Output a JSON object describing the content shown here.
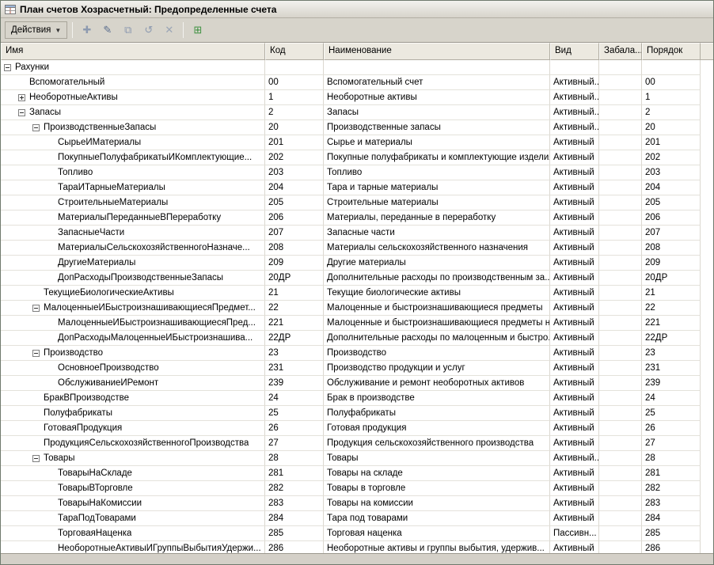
{
  "window": {
    "title": "План счетов Хозрасчетный: Предопределенные счета"
  },
  "toolbar": {
    "actions_label": "Действия",
    "dropdown_arrow": "▼",
    "buttons": [
      {
        "name": "add",
        "glyph": "✚",
        "color": "#8d9ab0"
      },
      {
        "name": "edit",
        "glyph": "✎",
        "color": "#5b6e8e"
      },
      {
        "name": "copy",
        "glyph": "⧉",
        "color": "#8d9ab0"
      },
      {
        "name": "history",
        "glyph": "↺",
        "color": "#8d9ab0"
      },
      {
        "name": "delete",
        "glyph": "✕",
        "color": "#9aa5b6"
      },
      {
        "name": "add-group",
        "glyph": "⊞",
        "color": "#3d9140"
      }
    ]
  },
  "table": {
    "columns": [
      "Имя",
      "Код",
      "Наименование",
      "Вид",
      "Забала...",
      "Порядок"
    ],
    "rows": [
      {
        "level": 0,
        "expander": "minus",
        "name": "Рахунки",
        "code": "",
        "full_name": "",
        "kind": "",
        "offbalance": "",
        "order": ""
      },
      {
        "level": 1,
        "expander": "leaf",
        "name": "Вспомогательный",
        "code": "00",
        "full_name": "Вспомогательный счет",
        "kind": "Активный...",
        "offbalance": "",
        "order": "00"
      },
      {
        "level": 1,
        "expander": "plus",
        "name": "НеоборотныеАктивы",
        "code": "1",
        "full_name": "Необоротные активы",
        "kind": "Активный...",
        "offbalance": "",
        "order": "1"
      },
      {
        "level": 1,
        "expander": "minus",
        "name": "Запасы",
        "code": "2",
        "full_name": "Запасы",
        "kind": "Активный...",
        "offbalance": "",
        "order": "2"
      },
      {
        "level": 2,
        "expander": "minus",
        "name": "ПроизводственныеЗапасы",
        "code": "20",
        "full_name": "Производственные запасы",
        "kind": "Активный...",
        "offbalance": "",
        "order": "20"
      },
      {
        "level": 3,
        "expander": "leaf",
        "name": "СырьеИМатериалы",
        "code": "201",
        "full_name": "Сырье и материалы",
        "kind": "Активный",
        "offbalance": "",
        "order": "201"
      },
      {
        "level": 3,
        "expander": "leaf",
        "name": "ПокупныеПолуфабрикатыИКомплектующие...",
        "code": "202",
        "full_name": "Покупные полуфабрикаты и комплектующие изделия",
        "kind": "Активный",
        "offbalance": "",
        "order": "202"
      },
      {
        "level": 3,
        "expander": "leaf",
        "name": "Топливо",
        "code": "203",
        "full_name": "Топливо",
        "kind": "Активный",
        "offbalance": "",
        "order": "203"
      },
      {
        "level": 3,
        "expander": "leaf",
        "name": "ТараИТарныеМатериалы",
        "code": "204",
        "full_name": "Тара и тарные материалы",
        "kind": "Активный",
        "offbalance": "",
        "order": "204"
      },
      {
        "level": 3,
        "expander": "leaf",
        "name": "СтроительныеМатериалы",
        "code": "205",
        "full_name": "Строительные материалы",
        "kind": "Активный",
        "offbalance": "",
        "order": "205"
      },
      {
        "level": 3,
        "expander": "leaf",
        "name": "МатериалыПереданныеВПереработку",
        "code": "206",
        "full_name": "Материалы, переданные в переработку",
        "kind": "Активный",
        "offbalance": "",
        "order": "206"
      },
      {
        "level": 3,
        "expander": "leaf",
        "name": "ЗапасныеЧасти",
        "code": "207",
        "full_name": "Запасные части",
        "kind": "Активный",
        "offbalance": "",
        "order": "207"
      },
      {
        "level": 3,
        "expander": "leaf",
        "name": "МатериалыСельскохозяйственногоНазначе...",
        "code": "208",
        "full_name": "Материалы сельскохозяйственного назначения",
        "kind": "Активный",
        "offbalance": "",
        "order": "208"
      },
      {
        "level": 3,
        "expander": "leaf",
        "name": "ДругиеМатериалы",
        "code": "209",
        "full_name": "Другие материалы",
        "kind": "Активный",
        "offbalance": "",
        "order": "209"
      },
      {
        "level": 3,
        "expander": "leaf",
        "name": "ДопРасходыПроизводственныеЗапасы",
        "code": "20ДР",
        "full_name": "Дополнительные расходы по производственным за...",
        "kind": "Активный",
        "offbalance": "",
        "order": "20ДР"
      },
      {
        "level": 2,
        "expander": "leaf",
        "name": "ТекущиеБиологическиеАктивы",
        "code": "21",
        "full_name": "Текущие биологические активы",
        "kind": "Активный",
        "offbalance": "",
        "order": "21"
      },
      {
        "level": 2,
        "expander": "minus",
        "name": "МалоценныеИБыстроизнашивающиесяПредмет...",
        "code": "22",
        "full_name": "Малоценные и быстроизнашивающиеся предметы",
        "kind": "Активный",
        "offbalance": "",
        "order": "22"
      },
      {
        "level": 3,
        "expander": "leaf",
        "name": "МалоценныеИБыстроизнашивающиесяПред...",
        "code": "221",
        "full_name": "Малоценные и быстроизнашивающиеся предметы н...",
        "kind": "Активный",
        "offbalance": "",
        "order": "221"
      },
      {
        "level": 3,
        "expander": "leaf",
        "name": "ДопРасходыМалоценныеИБыстроизнашива...",
        "code": "22ДР",
        "full_name": "Дополнительные расходы по малоценным и быстро...",
        "kind": "Активный",
        "offbalance": "",
        "order": "22ДР"
      },
      {
        "level": 2,
        "expander": "minus",
        "name": "Производство",
        "code": "23",
        "full_name": "Производство",
        "kind": "Активный",
        "offbalance": "",
        "order": "23"
      },
      {
        "level": 3,
        "expander": "leaf",
        "name": "ОсновноеПроизводство",
        "code": "231",
        "full_name": "Производство продукции и услуг",
        "kind": "Активный",
        "offbalance": "",
        "order": "231"
      },
      {
        "level": 3,
        "expander": "leaf",
        "name": "ОбслуживаниеИРемонт",
        "code": "239",
        "full_name": "Обслуживание и ремонт необоротных активов",
        "kind": "Активный",
        "offbalance": "",
        "order": "239"
      },
      {
        "level": 2,
        "expander": "leaf",
        "name": "БракВПроизводстве",
        "code": "24",
        "full_name": "Брак в производстве",
        "kind": "Активный",
        "offbalance": "",
        "order": "24"
      },
      {
        "level": 2,
        "expander": "leaf",
        "name": "Полуфабрикаты",
        "code": "25",
        "full_name": "Полуфабрикаты",
        "kind": "Активный",
        "offbalance": "",
        "order": "25"
      },
      {
        "level": 2,
        "expander": "leaf",
        "name": "ГотоваяПродукция",
        "code": "26",
        "full_name": "Готовая продукция",
        "kind": "Активный",
        "offbalance": "",
        "order": "26"
      },
      {
        "level": 2,
        "expander": "leaf",
        "name": "ПродукцияСельскохозяйственногоПроизводства",
        "code": "27",
        "full_name": "Продукция сельскохозяйственного производства",
        "kind": "Активный",
        "offbalance": "",
        "order": "27"
      },
      {
        "level": 2,
        "expander": "minus",
        "name": "Товары",
        "code": "28",
        "full_name": "Товары",
        "kind": "Активный...",
        "offbalance": "",
        "order": "28"
      },
      {
        "level": 3,
        "expander": "leaf",
        "name": "ТоварыНаСкладе",
        "code": "281",
        "full_name": "Товары на складе",
        "kind": "Активный",
        "offbalance": "",
        "order": "281"
      },
      {
        "level": 3,
        "expander": "leaf",
        "name": "ТоварыВТорговле",
        "code": "282",
        "full_name": "Товары в торговле",
        "kind": "Активный",
        "offbalance": "",
        "order": "282"
      },
      {
        "level": 3,
        "expander": "leaf",
        "name": "ТоварыНаКомиссии",
        "code": "283",
        "full_name": "Товары на комиссии",
        "kind": "Активный",
        "offbalance": "",
        "order": "283"
      },
      {
        "level": 3,
        "expander": "leaf",
        "name": "ТараПодТоварами",
        "code": "284",
        "full_name": "Тара под товарами",
        "kind": "Активный",
        "offbalance": "",
        "order": "284"
      },
      {
        "level": 3,
        "expander": "leaf",
        "name": "ТорговаяНаценка",
        "code": "285",
        "full_name": "Торговая наценка",
        "kind": "Пассивн...",
        "offbalance": "",
        "order": "285"
      },
      {
        "level": 3,
        "expander": "leaf",
        "name": "НеоборотныеАктивыИГруппыВыбытияУдержи...",
        "code": "286",
        "full_name": "Необоротные активы и группы выбытия, удержив...",
        "kind": "Активный",
        "offbalance": "",
        "order": "286"
      }
    ]
  }
}
